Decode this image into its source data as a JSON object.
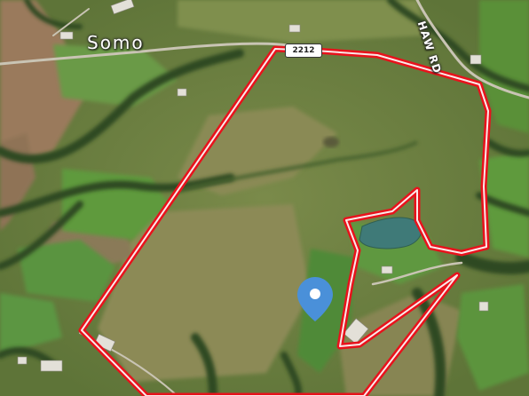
{
  "map": {
    "type": "satellite",
    "labels": {
      "town": "Somo",
      "road_name": "HAW RD",
      "route_shield": "2212"
    },
    "boundary_color": "#e8121c",
    "pin_color": "#4a90d9",
    "markers": [
      {
        "name": "property-pin",
        "icon": "location-pin-icon"
      }
    ]
  }
}
